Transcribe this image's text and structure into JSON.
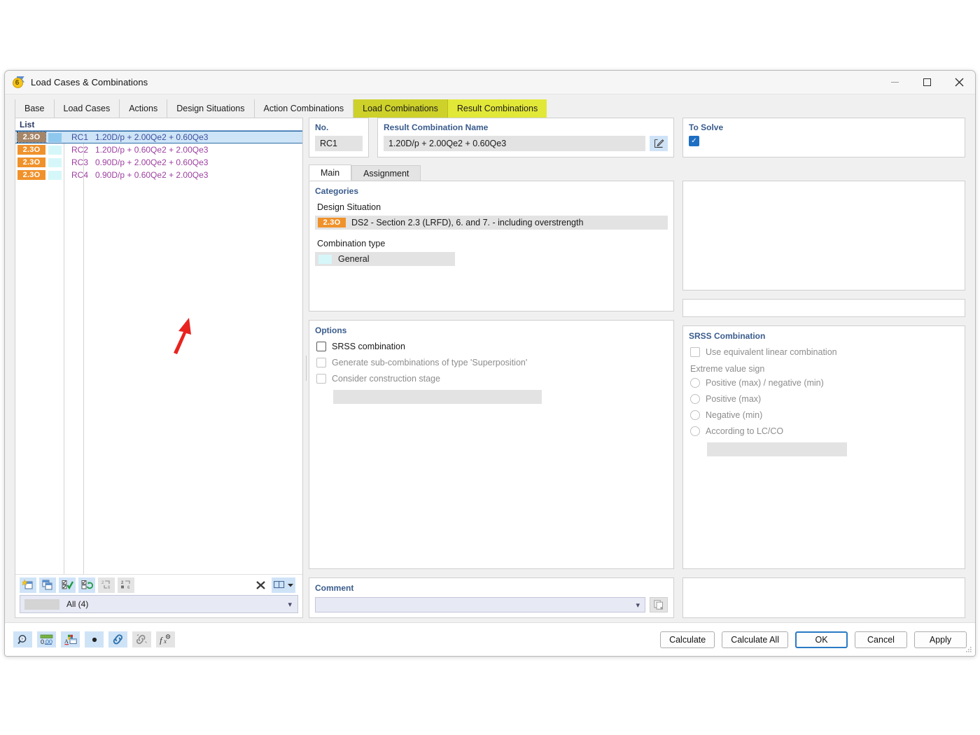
{
  "window": {
    "title": "Load Cases & Combinations",
    "app_icon": "rfem-badge-icon",
    "icon_number": "6",
    "minimize_label": "Minimize",
    "maximize_label": "Maximize",
    "close_label": "Close"
  },
  "tabs": [
    {
      "label": "Base",
      "state": "normal"
    },
    {
      "label": "Load Cases",
      "state": "normal"
    },
    {
      "label": "Actions",
      "state": "normal"
    },
    {
      "label": "Design Situations",
      "state": "normal"
    },
    {
      "label": "Action Combinations",
      "state": "normal"
    },
    {
      "label": "Load Combinations",
      "state": "highlight-olive"
    },
    {
      "label": "Result Combinations",
      "state": "highlight-yellow"
    }
  ],
  "list": {
    "header": "List",
    "rows": [
      {
        "badge": "2.3O",
        "no": "RC1",
        "description": "1.20D/p + 2.00Qe2 + 0.60Qe3",
        "selected": true
      },
      {
        "badge": "2.3O",
        "no": "RC2",
        "description": "1.20D/p + 0.60Qe2 + 2.00Qe3",
        "selected": false
      },
      {
        "badge": "2.3O",
        "no": "RC3",
        "description": "0.90D/p + 2.00Qe2 + 0.60Qe3",
        "selected": false
      },
      {
        "badge": "2.3O",
        "no": "RC4",
        "description": "0.90D/p + 0.60Qe2 + 2.00Qe3",
        "selected": false
      }
    ],
    "toolbar": [
      {
        "icon": "new-combination-icon",
        "enabled": true
      },
      {
        "icon": "duplicate-combination-icon",
        "enabled": true
      },
      {
        "icon": "select-all-check-icon",
        "enabled": true
      },
      {
        "icon": "invert-selection-icon",
        "enabled": true
      },
      {
        "icon": "renumber-icon",
        "enabled": false
      },
      {
        "icon": "sort-icon",
        "enabled": false
      },
      {
        "icon": "delete-icon",
        "enabled": true
      },
      {
        "icon": "table-view-icon",
        "enabled": true
      },
      {
        "icon": "table-view-dropdown-icon",
        "enabled": true
      }
    ],
    "filter_label": "All (4)"
  },
  "detail": {
    "no_label": "No.",
    "no_value": "RC1",
    "name_label": "Result Combination Name",
    "name_value": "1.20D/p + 2.00Qe2 + 0.60Qe3",
    "name_edit_icon": "edit-pencil-icon",
    "to_solve_label": "To Solve",
    "to_solve_checked": true,
    "inner_tabs": [
      {
        "label": "Main",
        "active": true
      },
      {
        "label": "Assignment",
        "active": false
      }
    ],
    "categories": {
      "title": "Categories",
      "design_situation_label": "Design Situation",
      "design_situation_badge": "2.3O",
      "design_situation_value": "DS2 - Section 2.3 (LRFD), 6. and 7. - including overstrength",
      "combination_type_label": "Combination type",
      "combination_type_value": "General"
    },
    "options": {
      "title": "Options",
      "items": [
        {
          "label": "SRSS combination",
          "checked": false,
          "enabled": true
        },
        {
          "label": "Generate sub-combinations of type 'Superposition'",
          "checked": false,
          "enabled": false
        },
        {
          "label": "Consider construction stage",
          "checked": false,
          "enabled": false
        }
      ]
    },
    "srss": {
      "title": "SRSS Combination",
      "use_equivalent_label": "Use equivalent linear combination",
      "use_equivalent_checked": false,
      "extreme_value_label": "Extreme value sign",
      "radios": [
        {
          "label": "Positive (max) / negative (min)",
          "selected": false
        },
        {
          "label": "Positive (max)",
          "selected": false
        },
        {
          "label": "Negative (min)",
          "selected": false
        },
        {
          "label": "According to LC/CO",
          "selected": false
        }
      ]
    },
    "comment": {
      "label": "Comment",
      "value": "",
      "copy_icon": "copy-icon"
    }
  },
  "footer": {
    "tools": [
      {
        "icon": "search-magnifier-icon",
        "enabled": true
      },
      {
        "icon": "number-format-icon",
        "enabled": true
      },
      {
        "icon": "colors-icon",
        "enabled": true
      },
      {
        "icon": "dot-icon",
        "enabled": true
      },
      {
        "icon": "link-icon",
        "enabled": true
      },
      {
        "icon": "unlink-icon",
        "enabled": false
      },
      {
        "icon": "formula-icon",
        "enabled": false
      }
    ],
    "buttons": [
      {
        "label": "Calculate",
        "default": false
      },
      {
        "label": "Calculate All",
        "default": false
      },
      {
        "label": "OK",
        "default": true
      },
      {
        "label": "Cancel",
        "default": false
      },
      {
        "label": "Apply",
        "default": false
      }
    ]
  },
  "annotation": {
    "arrow_color": "#e8231f",
    "arrow_target": "list-row-rc4"
  },
  "colors": {
    "badge_orange": "#f0922b",
    "tab_highlight_olive": "#cdd12a",
    "tab_highlight_yellow": "#e2e838",
    "selection_blue": "#cee4f7",
    "row_text_purple": "#9c3fa0",
    "accent_blue": "#1e6fc4",
    "group_label_blue": "#3a5c8c"
  }
}
